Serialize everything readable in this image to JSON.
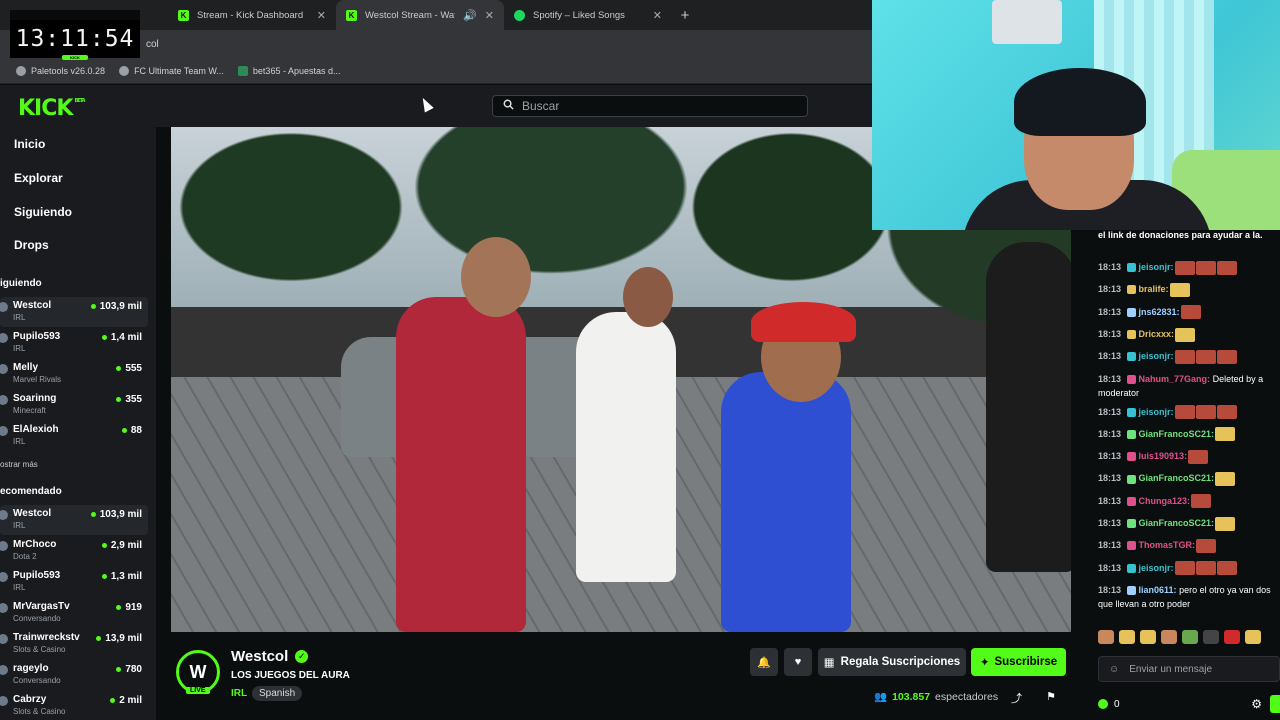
{
  "browser": {
    "tabs": [
      {
        "title": "Stream - Kick Dashboard",
        "icon": "kick-icon",
        "color": "#53fc18"
      },
      {
        "title": "Westcol Stream - Watch Live",
        "icon": "kick-icon",
        "color": "#53fc18"
      },
      {
        "title": "Spotify – Liked Songs",
        "icon": "spotify-icon",
        "color": "#1ed760"
      }
    ],
    "address_fragment": "col",
    "bookmarks": [
      "Paletools v26.0.28",
      "FC Ultimate Team W...",
      "bet365 - Apuestas d..."
    ]
  },
  "overlay": {
    "clock": "13:11:54",
    "clock_label": "KICK"
  },
  "header": {
    "logo": "KICK",
    "logo_sup": "BETA",
    "search_placeholder": "Buscar"
  },
  "sidebar": {
    "nav": [
      "Inicio",
      "Explorar",
      "Siguiendo",
      "Drops"
    ],
    "following_label": "iguiendo",
    "following": [
      {
        "name": "Westcol",
        "category": "IRL",
        "viewers": "103,9 mil"
      },
      {
        "name": "Pupilo593",
        "category": "IRL",
        "viewers": "1,4 mil"
      },
      {
        "name": "Melly",
        "category": "Marvel Rivals",
        "viewers": "555"
      },
      {
        "name": "Soarinng",
        "category": "Minecraft",
        "viewers": "355"
      },
      {
        "name": "ElAlexioh",
        "category": "IRL",
        "viewers": "88"
      }
    ],
    "show_more": "ostrar más",
    "recommended_label": "ecomendado",
    "recommended": [
      {
        "name": "Westcol",
        "category": "IRL",
        "viewers": "103,9 mil"
      },
      {
        "name": "MrChoco",
        "category": "Dota 2",
        "viewers": "2,9 mil"
      },
      {
        "name": "Pupilo593",
        "category": "IRL",
        "viewers": "1,3 mil"
      },
      {
        "name": "MrVargasTv",
        "category": "Conversando",
        "viewers": "919"
      },
      {
        "name": "Trainwreckstv",
        "category": "Slots & Casino",
        "viewers": "13,9 mil"
      },
      {
        "name": "rageylo",
        "category": "Conversando",
        "viewers": "780"
      },
      {
        "name": "Cabrzy",
        "category": "Slots & Casino",
        "viewers": "2 mil"
      }
    ]
  },
  "stream": {
    "channel": "Westcol",
    "avatar_letter": "W",
    "live_badge": "LIVE",
    "title": "LOS JUEGOS DEL AURA",
    "category": "IRL",
    "tag": "Spanish",
    "gift_label": "Regala Suscripciones",
    "subscribe_label": "Suscribirse",
    "viewers": "103.857",
    "viewers_suffix": "espectadores"
  },
  "chat": {
    "top_line": "el link de donaciones para ayudar a la.",
    "messages": [
      {
        "time": "18:13",
        "user": "jeisonjr:",
        "color": "#37c2d1",
        "text": "",
        "emotes": 3
      },
      {
        "time": "18:13",
        "user": "bralife:",
        "color": "#e6c25a",
        "text": "",
        "emotes": 1
      },
      {
        "time": "18:13",
        "user": "jns62831:",
        "color": "#9fd0ff",
        "text": "",
        "emotes": 1
      },
      {
        "time": "18:13",
        "user": "Dricxxx:",
        "color": "#e6c25a",
        "text": "",
        "emotes": 1
      },
      {
        "time": "18:13",
        "user": "jeisonjr:",
        "color": "#37c2d1",
        "text": "",
        "emotes": 3
      },
      {
        "time": "18:13",
        "user": "Nahum_77Gang:",
        "color": "#e0508a",
        "text": "Deleted by a moderator",
        "emotes": 0
      },
      {
        "time": "18:13",
        "user": "jeisonjr:",
        "color": "#37c2d1",
        "text": "",
        "emotes": 3
      },
      {
        "time": "18:13",
        "user": "GianFrancoSC21:",
        "color": "#6ee27c",
        "text": "",
        "emotes": 1
      },
      {
        "time": "18:13",
        "user": "luis190913:",
        "color": "#e0508a",
        "text": "",
        "emotes": 1
      },
      {
        "time": "18:13",
        "user": "GianFrancoSC21:",
        "color": "#6ee27c",
        "text": "",
        "emotes": 1
      },
      {
        "time": "18:13",
        "user": "Chunga123:",
        "color": "#e0508a",
        "text": "",
        "emotes": 1
      },
      {
        "time": "18:13",
        "user": "GianFrancoSC21:",
        "color": "#6ee27c",
        "text": "",
        "emotes": 1
      },
      {
        "time": "18:13",
        "user": "ThomasTGR:",
        "color": "#e0508a",
        "text": "",
        "emotes": 1
      },
      {
        "time": "18:13",
        "user": "jeisonjr:",
        "color": "#37c2d1",
        "text": "",
        "emotes": 3
      },
      {
        "time": "18:13",
        "user": "lian0611:",
        "color": "#9fd0ff",
        "text": "pero el otro ya van dos que llevan a otro poder",
        "emotes": 0
      }
    ],
    "input_placeholder": "Enviar un mensaje",
    "kicks": "0"
  },
  "colors": {
    "brand": "#53fc18",
    "bg": "#0b0e0f",
    "panel": "#191b1f"
  }
}
